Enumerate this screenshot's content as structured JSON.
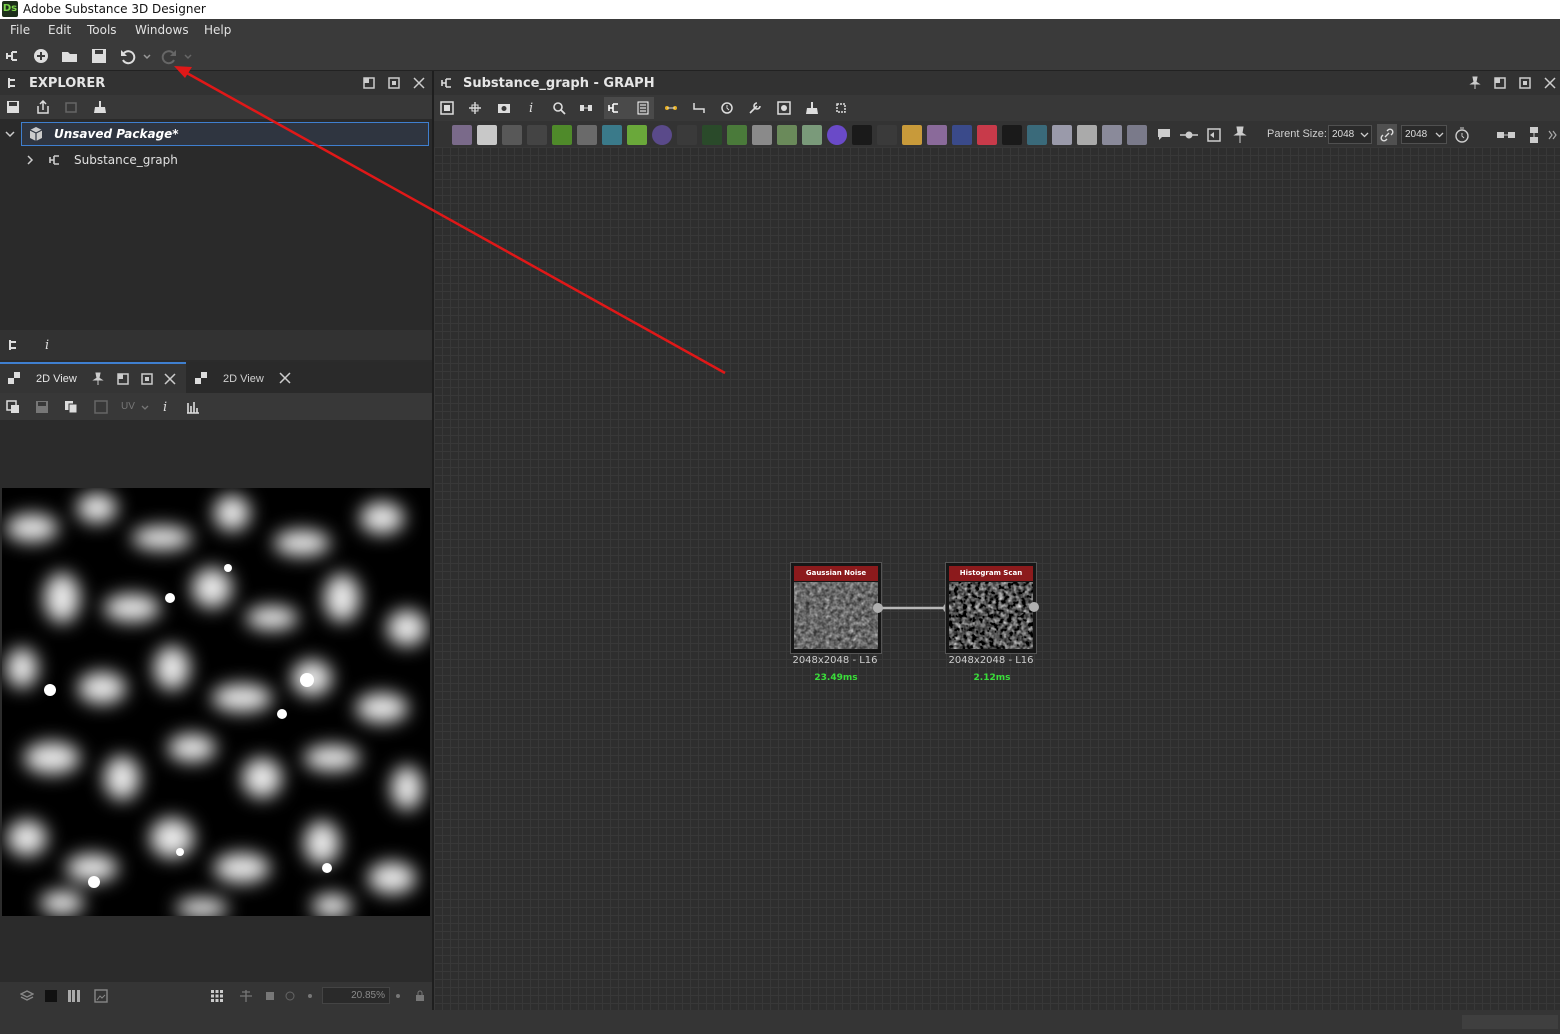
{
  "app": {
    "title": "Adobe Substance 3D Designer",
    "logo_text": "Ds"
  },
  "menu": [
    "File",
    "Edit",
    "Tools",
    "Windows",
    "Help"
  ],
  "explorer": {
    "title": "EXPLORER",
    "package_label": "Unsaved Package*",
    "graph_label": "Substance_graph"
  },
  "view2d": {
    "tab1_label": "2D View",
    "tab2_label": "2D View",
    "uv_label": "UV",
    "zoom": "20.85%"
  },
  "graph": {
    "title": "Substance_graph - GRAPH",
    "parent_size_label": "Parent Size:",
    "parent_size_value": "2048",
    "size_value": "2048",
    "nodes": [
      {
        "title": "Gaussian Noise",
        "size": "2048x2048 - L16",
        "time": "23.49ms"
      },
      {
        "title": "Histogram Scan",
        "size": "2048x2048 - L16",
        "time": "2.12ms"
      }
    ]
  },
  "colors": {
    "node_header": "#8c1a1c",
    "time_text": "#3adf3a",
    "annotation_arrow": "#e01818",
    "selection_border": "#3f7fcf"
  }
}
